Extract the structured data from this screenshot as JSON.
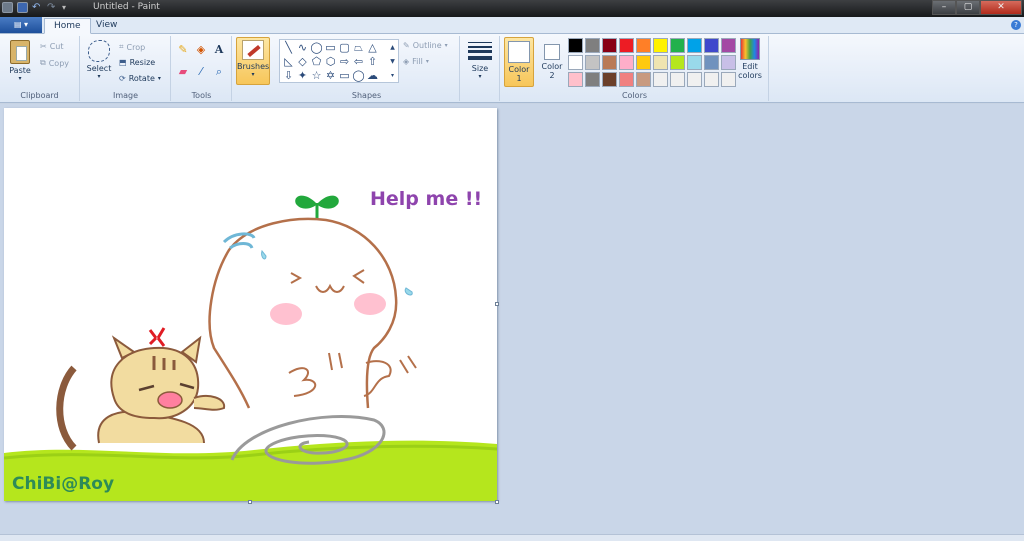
{
  "window": {
    "title": "Untitled - Paint"
  },
  "tabs": [
    {
      "label": "Home"
    },
    {
      "label": "View"
    }
  ],
  "ribbon": {
    "clipboard": {
      "group_label": "Clipboard",
      "paste": "Paste",
      "cut": "Cut",
      "copy": "Copy"
    },
    "image": {
      "group_label": "Image",
      "select": "Select",
      "crop": "Crop",
      "resize": "Resize",
      "rotate": "Rotate"
    },
    "tools": {
      "group_label": "Tools"
    },
    "brushes": {
      "label": "Brushes"
    },
    "shapes": {
      "group_label": "Shapes",
      "outline": "Outline",
      "fill": "Fill"
    },
    "size": {
      "label": "Size"
    },
    "colors": {
      "group_label": "Colors",
      "color1": "Color",
      "color1_num": "1",
      "color2": "Color",
      "color2_num": "2",
      "edit_colors_1": "Edit",
      "edit_colors_2": "colors",
      "palette": [
        "#000000",
        "#7f7f7f",
        "#880015",
        "#ed1c24",
        "#ff7f27",
        "#fff200",
        "#22b14c",
        "#00a2e8",
        "#3f48cc",
        "#a349a4",
        "#ffffff",
        "#c3c3c3",
        "#b97a57",
        "#ffaec9",
        "#ffc90e",
        "#efe4b0",
        "#b5e61d",
        "#99d9ea",
        "#7092be",
        "#c8bfe7",
        "#ffc0cb",
        "#7f7f7f",
        "#6b3f2a",
        "#f08080",
        "#c89a80",
        "#f0f0f0",
        "#f0f0f0",
        "#f0f0f0",
        "#f0f0f0",
        "#f0f0f0"
      ]
    }
  },
  "drawing": {
    "caption": "Help me !!",
    "signature": "ChiBi@Roy",
    "caption_color": "#8e44ad",
    "signature_color": "#2e8b57"
  }
}
